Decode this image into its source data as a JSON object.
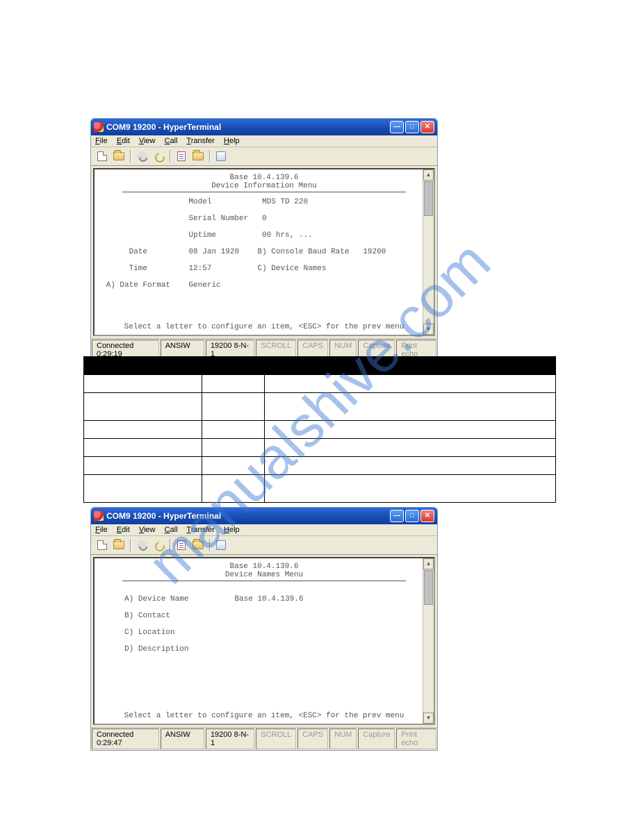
{
  "watermark": "manualshive.com",
  "window1": {
    "title": "COM9 19200 - HyperTerminal",
    "menus": [
      "File",
      "Edit",
      "View",
      "Call",
      "Transfer",
      "Help"
    ],
    "header_line1": "Base 10.4.139.6",
    "header_line2": "Device Information Menu",
    "rows": {
      "model_label": "Model",
      "model_val": "MDS TD 220",
      "sn_label": "Serial Number",
      "sn_val": "0",
      "uptime_label": "Uptime",
      "uptime_val": "00 hrs, ...",
      "date_label": "Date",
      "date_val": "08 Jan 1920",
      "b_label": "B) Console Baud Rate",
      "b_val": "19200",
      "time_label": "Time",
      "time_val": "12:57",
      "c_label": "C) Device Names",
      "a_label": "A) Date Format",
      "a_val": "Generic"
    },
    "footer": "Select a letter to configure an item, <ESC> for the prev menu",
    "status": {
      "conn": "Connected 0:29:19",
      "emul": "ANSIW",
      "params": "19200 8-N-1",
      "scroll": "SCROLL",
      "caps": "CAPS",
      "num": "NUM",
      "capture": "Capture",
      "echo": "Print echo"
    }
  },
  "window2": {
    "title": "COM9 19200 - HyperTerminal",
    "menus": [
      "File",
      "Edit",
      "View",
      "Call",
      "Transfer",
      "Help"
    ],
    "header_line1": "Base 10.4.139.6",
    "header_line2": "Device Names Menu",
    "rows": {
      "a_label": "A) Device Name",
      "a_val": "Base 10.4.139.6",
      "b_label": "B) Contact",
      "c_label": "C) Location",
      "d_label": "D) Description"
    },
    "footer": "Select a letter to configure an item, <ESC> for the prev menu",
    "status": {
      "conn": "Connected 0:29:47",
      "emul": "ANSIW",
      "params": "19200 8-N-1",
      "scroll": "SCROLL",
      "caps": "CAPS",
      "num": "NUM",
      "capture": "Capture",
      "echo": "Print echo"
    }
  },
  "table": {
    "headers": [
      "",
      "",
      ""
    ],
    "rows": [
      [
        "",
        "",
        ""
      ],
      [
        "",
        "",
        ""
      ],
      [
        "",
        "",
        ""
      ],
      [
        "",
        "",
        ""
      ],
      [
        "",
        "",
        ""
      ],
      [
        "",
        "",
        ""
      ]
    ]
  }
}
